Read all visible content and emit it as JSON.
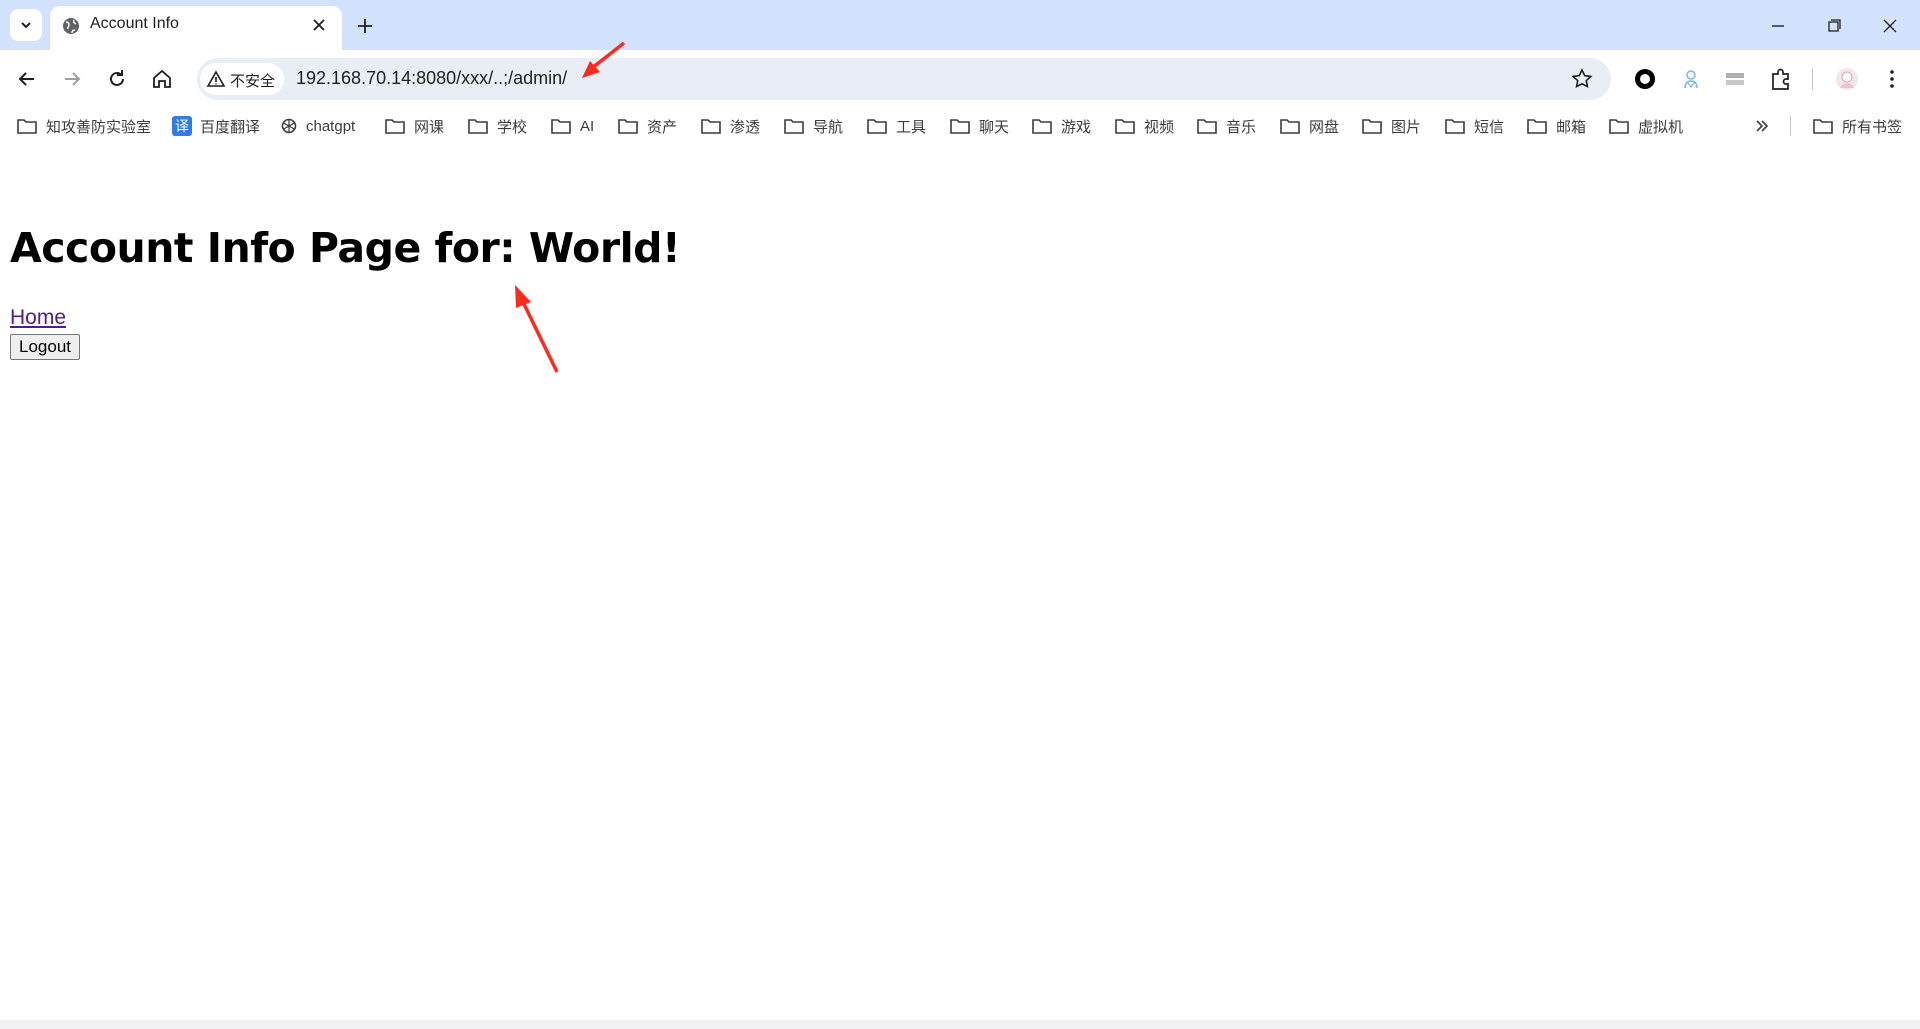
{
  "browser": {
    "tab": {
      "title": "Account Info"
    },
    "address_bar": {
      "security_label": "不安全",
      "url": "192.168.70.14:8080/xxx/..;/admin/"
    },
    "bookmarks": [
      {
        "label": "知攻善防实验室",
        "icon": "folder-icon"
      },
      {
        "label": "百度翻译",
        "icon": "translate-icon"
      },
      {
        "label": "chatgpt",
        "icon": "openai-icon"
      },
      {
        "label": "网课",
        "icon": "folder-icon"
      },
      {
        "label": "学校",
        "icon": "folder-icon"
      },
      {
        "label": "AI",
        "icon": "folder-icon"
      },
      {
        "label": "资产",
        "icon": "folder-icon"
      },
      {
        "label": "渗透",
        "icon": "folder-icon"
      },
      {
        "label": "导航",
        "icon": "folder-icon"
      },
      {
        "label": "工具",
        "icon": "folder-icon"
      },
      {
        "label": "聊天",
        "icon": "folder-icon"
      },
      {
        "label": "游戏",
        "icon": "folder-icon"
      },
      {
        "label": "视频",
        "icon": "folder-icon"
      },
      {
        "label": "音乐",
        "icon": "folder-icon"
      },
      {
        "label": "网盘",
        "icon": "folder-icon"
      },
      {
        "label": "图片",
        "icon": "folder-icon"
      },
      {
        "label": "短信",
        "icon": "folder-icon"
      },
      {
        "label": "邮箱",
        "icon": "folder-icon"
      },
      {
        "label": "虚拟机",
        "icon": "folder-icon"
      }
    ],
    "all_bookmarks_label": "所有书签",
    "translate_glyph": "译"
  },
  "page": {
    "heading": "Account Info Page for: World!",
    "home_link": "Home",
    "logout_button": "Logout"
  },
  "colors": {
    "tabstrip": "#d3e3fd",
    "omnibox": "#e9eef6",
    "link_visited": "#551a8b",
    "annotation_arrow": "#ff2a1f"
  }
}
